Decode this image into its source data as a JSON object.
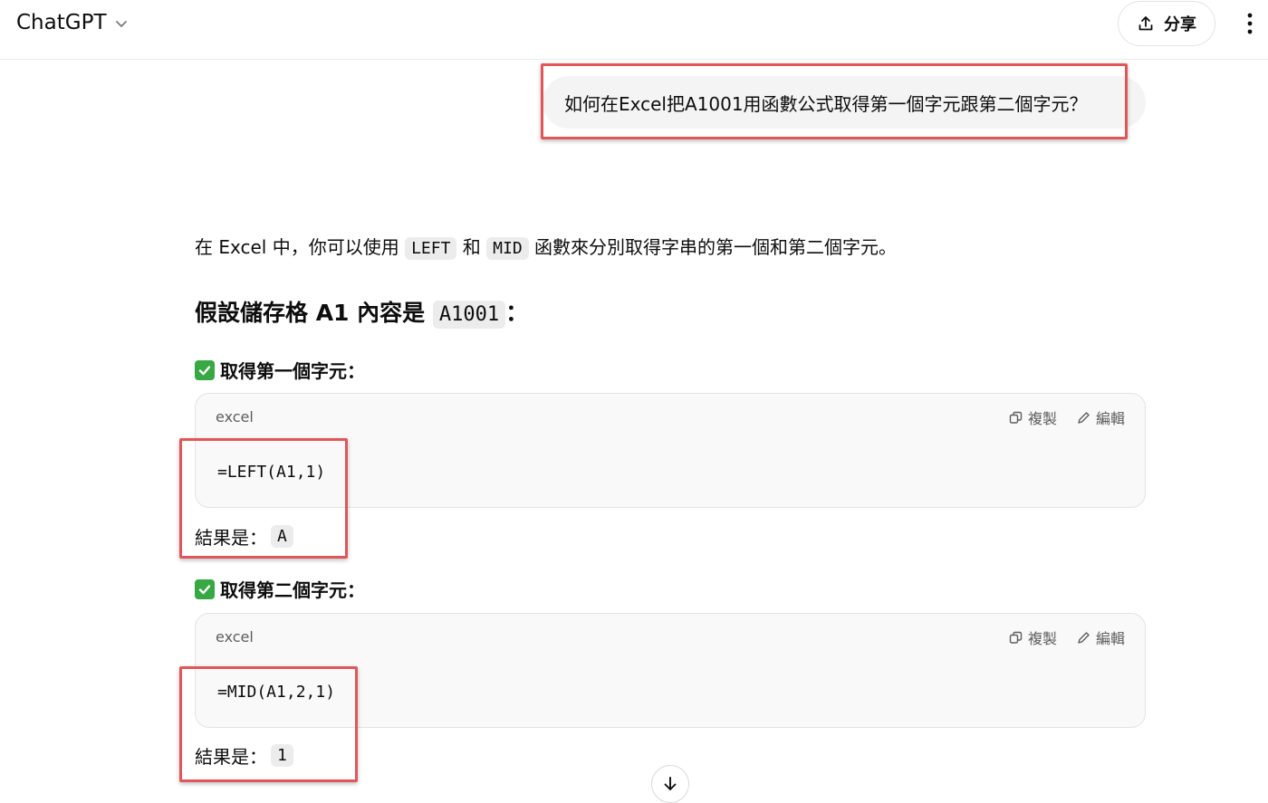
{
  "header": {
    "title": "ChatGPT",
    "share_label": "分享"
  },
  "user_message": "如何在Excel把A1001用函數公式取得第一個字元跟第二個字元？",
  "answer": {
    "intro": {
      "before": "在 Excel 中，你可以使用 ",
      "func1": "LEFT",
      "and": " 和 ",
      "func2": "MID",
      "after": " 函數來分別取得字串的第一個和第二個字元。"
    },
    "heading": {
      "before": "假設儲存格 A1 內容是 ",
      "value": "A1001",
      "after": "："
    },
    "sections": [
      {
        "title": "取得第一個字元：",
        "code_lang": "excel",
        "copy_label": "複製",
        "edit_label": "編輯",
        "code": "=LEFT(A1,1)",
        "result_label": "結果是：",
        "result_value": "A"
      },
      {
        "title": "取得第二個字元：",
        "code_lang": "excel",
        "copy_label": "複製",
        "edit_label": "編輯",
        "code": "=MID(A1,2,1)",
        "result_label": "結果是：",
        "result_value": "1"
      }
    ]
  },
  "colors": {
    "highlight_box": "#e0575a",
    "check_green": "#38a845"
  }
}
